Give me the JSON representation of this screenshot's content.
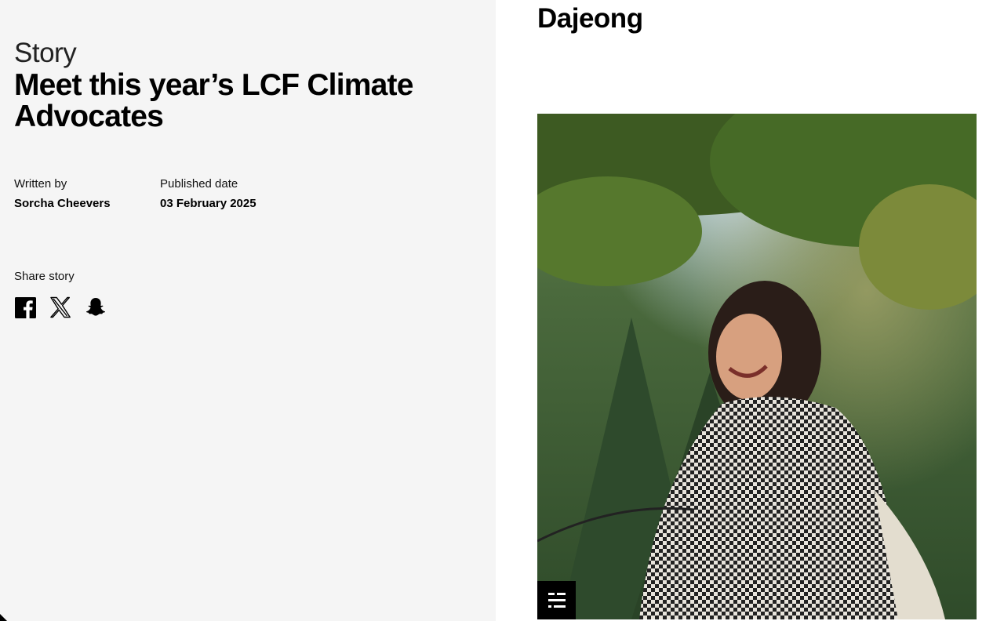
{
  "story": {
    "kicker": "Story",
    "title": "Meet this year’s LCF Climate Advocates",
    "written_by_label": "Written by",
    "author": "Sorcha Cheevers",
    "published_label": "Published date",
    "published_date": "03 February 2025",
    "share_label": "Share story",
    "share_icons": [
      "facebook-icon",
      "x-icon",
      "snapchat-icon"
    ]
  },
  "profile": {
    "name": "Dajeong",
    "image_alt": "Portrait of Dajeong smiling outdoors under trees",
    "badge_icon": "caption-toggle-icon"
  },
  "colors": {
    "left_panel_bg": "#f5f5f5",
    "text": "#000000",
    "badge_bg": "#000000"
  }
}
